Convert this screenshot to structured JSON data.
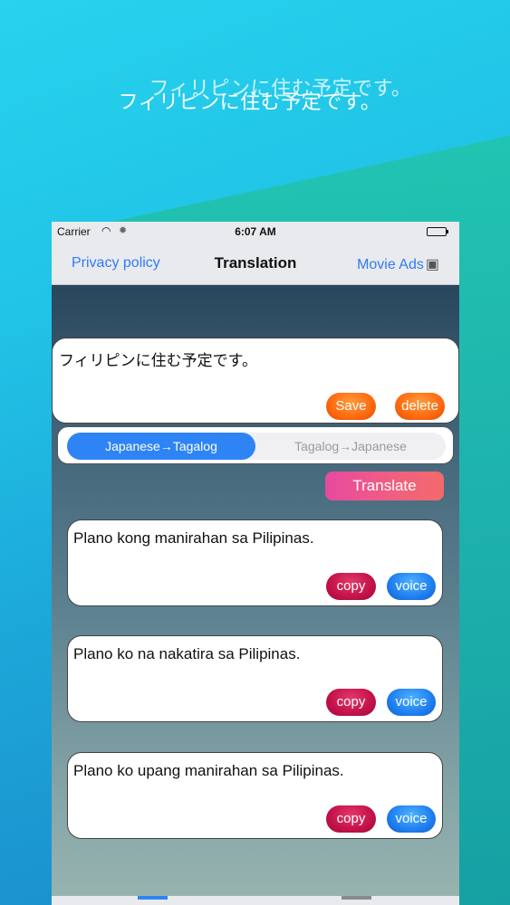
{
  "headline": "フィリピンに住む予定です。",
  "status_bar": {
    "carrier": "Carrier",
    "wifi_icon": "wifi-icon",
    "time": "6:07 AM",
    "battery_icon": "battery-icon"
  },
  "nav": {
    "left": "Privacy policy",
    "title": "Translation",
    "right": "Movie Ads",
    "right_icon": "video-camera-icon"
  },
  "input": {
    "text": "フィリピンに住む予定です。",
    "save_label": "Save",
    "delete_label": "delete"
  },
  "segment": {
    "options": [
      "Japanese→Tagalog",
      "Tagalog→Japanese"
    ],
    "selected": "Japanese→Tagalog"
  },
  "translate_label": "Translate",
  "results": [
    {
      "text": "Plano kong manirahan sa Pilipinas.",
      "copy_label": "copy",
      "voice_label": "voice"
    },
    {
      "text": "Plano ko na nakatira sa Pilipinas.",
      "copy_label": "copy",
      "voice_label": "voice"
    },
    {
      "text": "Plano ko upang manirahan sa Pilipinas.",
      "copy_label": "copy",
      "voice_label": "voice"
    }
  ],
  "colors": {
    "accent_blue": "#2f84f5",
    "save_orange": "#ff6a10",
    "copy_red": "#c4114a",
    "voice_blue": "#1f7ff0",
    "translate_pink": "#e64aa0"
  }
}
